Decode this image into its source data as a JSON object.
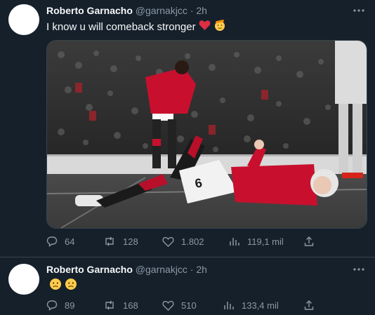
{
  "tweets": [
    {
      "name": "Roberto Garnacho",
      "handle": "@garnakjcc",
      "dot": "·",
      "time": "2h",
      "text": "I know u will comeback stronger",
      "emojis": [
        "red-heart",
        "saluting-face"
      ],
      "stats": {
        "replies": "64",
        "retweets": "128",
        "likes": "1.802",
        "views": "119,1 mil"
      },
      "media": {
        "alt": "",
        "jersey_number": "6"
      }
    },
    {
      "name": "Roberto Garnacho",
      "handle": "@garnakjcc",
      "dot": "·",
      "time": "2h",
      "text": "",
      "emojis": [
        "slightly-frowning-face",
        "slightly-frowning-face"
      ],
      "stats": {
        "replies": "89",
        "retweets": "168",
        "likes": "510",
        "views": "133,4 mil"
      }
    }
  ],
  "colors": {
    "background": "#15202b",
    "secondary_text": "#8b98a5",
    "divider": "#38444d",
    "heart": "#f91880",
    "emoji_yellow": "#ffcc4d"
  }
}
